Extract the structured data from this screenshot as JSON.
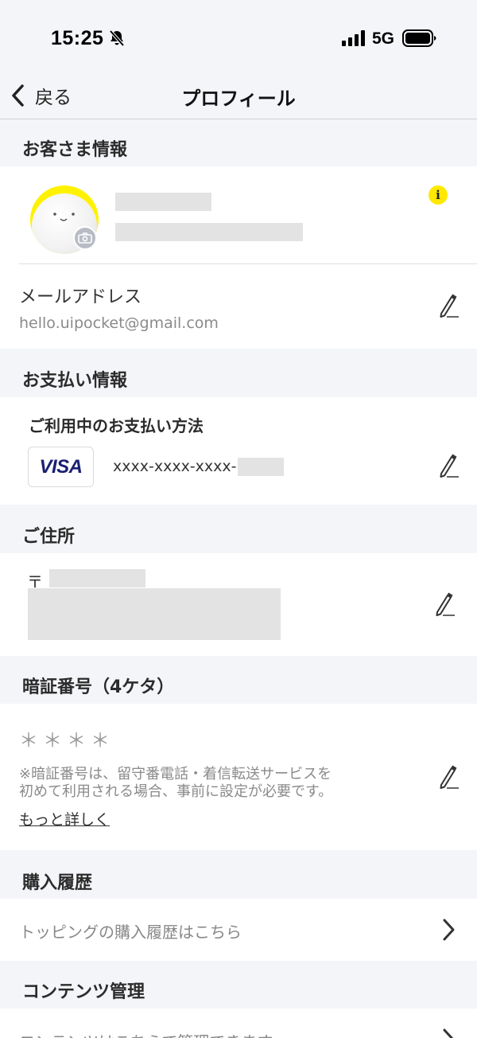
{
  "status_bar": {
    "time": "15:25",
    "network": "5G",
    "icons": [
      "bell-slash-icon",
      "signal-icon",
      "battery-icon"
    ]
  },
  "nav": {
    "back_label": "戻る",
    "title": "プロフィール",
    "icons": [
      "chevron-left-icon"
    ]
  },
  "customer": {
    "header": "お客さま情報",
    "avatar_color": "#fff200",
    "info_badge": "i",
    "email_label": "メールアドレス",
    "email_value": "hello.uipocket@gmail.com"
  },
  "payment": {
    "header": "お支払い情報",
    "method_label": "ご利用中のお支払い方法",
    "card_brand": "VISA",
    "card_number": "xxxx-xxxx-xxxx-"
  },
  "address": {
    "header": "ご住所",
    "postal_mark": "〒"
  },
  "pin": {
    "header": "暗証番号（4ケタ）",
    "masked_value": "＊＊＊＊",
    "note_line1": "※暗証番号は、留守番電話・着信転送サービスを",
    "note_line2": "初めて利用される場合、事前に設定が必要です。",
    "more_link": "もっと詳しく"
  },
  "purchase_history": {
    "header": "購入履歴",
    "link": "トッピングの購入履歴はこちら"
  },
  "content_management": {
    "header": "コンテンツ管理",
    "link": "コンテンツはこちらで管理できます"
  },
  "colors": {
    "background": "#f4f5f9",
    "accent_yellow": "#ffe900",
    "visa_blue": "#1a1f71"
  }
}
